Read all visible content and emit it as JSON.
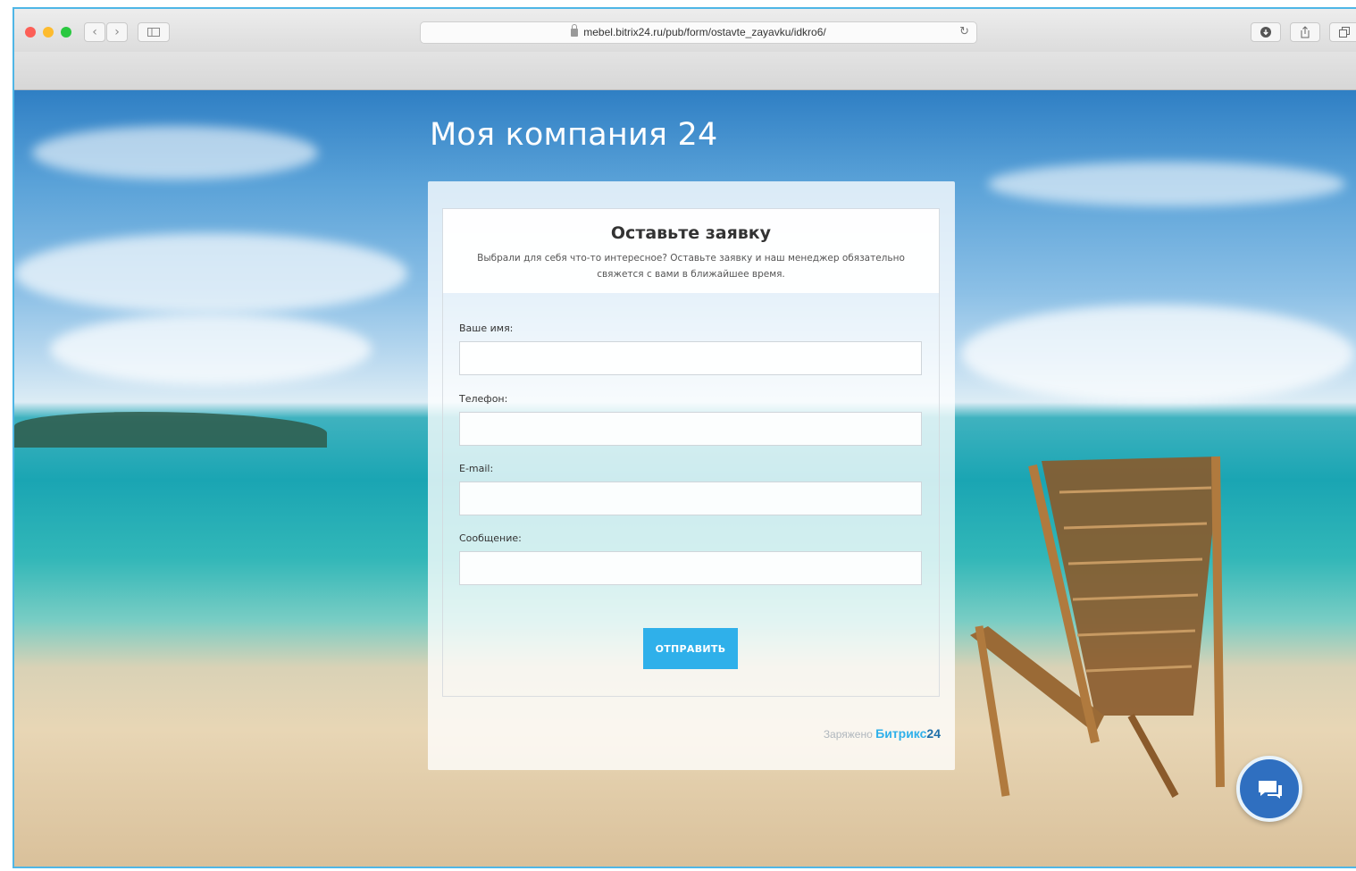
{
  "browser": {
    "url": "mebel.bitrix24.ru/pub/form/ostavte_zayavku/idkro6/",
    "icons": [
      "back-icon",
      "forward-icon",
      "sidebar-icon",
      "lock-icon",
      "reload-icon",
      "download-icon",
      "share-icon",
      "tabs-icon"
    ]
  },
  "page": {
    "company_name": "Моя компания",
    "company_suffix": "24",
    "form": {
      "title": "Оставьте заявку",
      "description": "Выбрали для себя что-то интересное? Оставьте заявку и наш менеджер обязательно свяжется с вами в ближайшее время.",
      "fields": [
        {
          "label": "Ваше имя:",
          "value": ""
        },
        {
          "label": "Телефон:",
          "value": ""
        },
        {
          "label": "E-mail:",
          "value": ""
        },
        {
          "label": "Сообщение:",
          "value": ""
        }
      ],
      "submit_label": "ОТПРАВИТЬ",
      "powered_prefix": "Заряжено",
      "powered_brand": "Битрикс",
      "powered_brand_num": "24"
    },
    "chat_icon": "chat-icon"
  },
  "colors": {
    "accent": "#2fb0ea",
    "chat_button": "#2f6fc0"
  }
}
